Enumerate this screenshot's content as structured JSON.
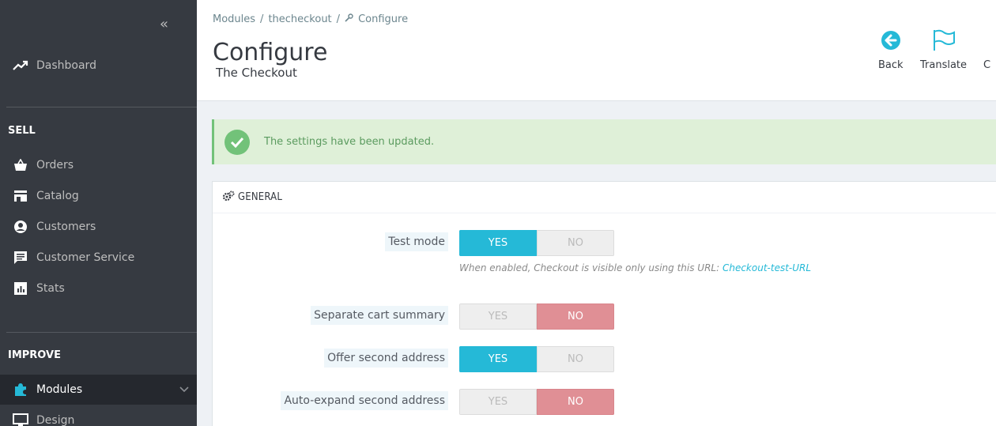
{
  "sidebar": {
    "collapse_icon": "double-chevron-left-icon",
    "dashboard": {
      "label": "Dashboard",
      "icon": "trending-up-icon"
    },
    "sections": [
      {
        "title": "SELL"
      },
      {
        "title": "IMPROVE"
      }
    ],
    "sell_items": [
      {
        "label": "Orders",
        "icon": "shopping-basket-icon"
      },
      {
        "label": "Catalog",
        "icon": "store-icon"
      },
      {
        "label": "Customers",
        "icon": "account-circle-icon"
      },
      {
        "label": "Customer Service",
        "icon": "chat-icon"
      },
      {
        "label": "Stats",
        "icon": "bar-chart-icon"
      }
    ],
    "improve_items": [
      {
        "label": "Modules",
        "icon": "puzzle-icon",
        "active": true
      },
      {
        "label": "Design",
        "icon": "desktop-icon"
      }
    ]
  },
  "header": {
    "breadcrumb": [
      "Modules",
      "thecheckout",
      "Configure"
    ],
    "separator": "/",
    "title": "Configure",
    "subtitle": "The Checkout",
    "toolbar": [
      {
        "label": "Back",
        "icon": "arrow-left-circle-icon"
      },
      {
        "label": "Translate",
        "icon": "flag-icon"
      },
      {
        "label": "C",
        "icon": ""
      }
    ]
  },
  "alert": {
    "message": "The settings have been updated.",
    "icon": "check-circle-icon"
  },
  "panel": {
    "title": "GENERAL",
    "icon": "cogs-icon",
    "settings": [
      {
        "label": "Test mode",
        "yes": "YES",
        "no": "NO",
        "value": "YES"
      },
      {
        "label": "Separate cart summary",
        "yes": "YES",
        "no": "NO",
        "value": "NO"
      },
      {
        "label": "Offer second address",
        "yes": "YES",
        "no": "NO",
        "value": "YES"
      },
      {
        "label": "Auto-expand second address",
        "yes": "YES",
        "no": "NO",
        "value": "NO"
      }
    ],
    "help_text": "When enabled, Checkout is visible only using this URL:",
    "help_link": "Checkout-test-URL"
  },
  "colors": {
    "sidebar_bg": "#363a41",
    "accent": "#25b9d7",
    "no_active": "#e08f95",
    "success": "#72c279"
  }
}
